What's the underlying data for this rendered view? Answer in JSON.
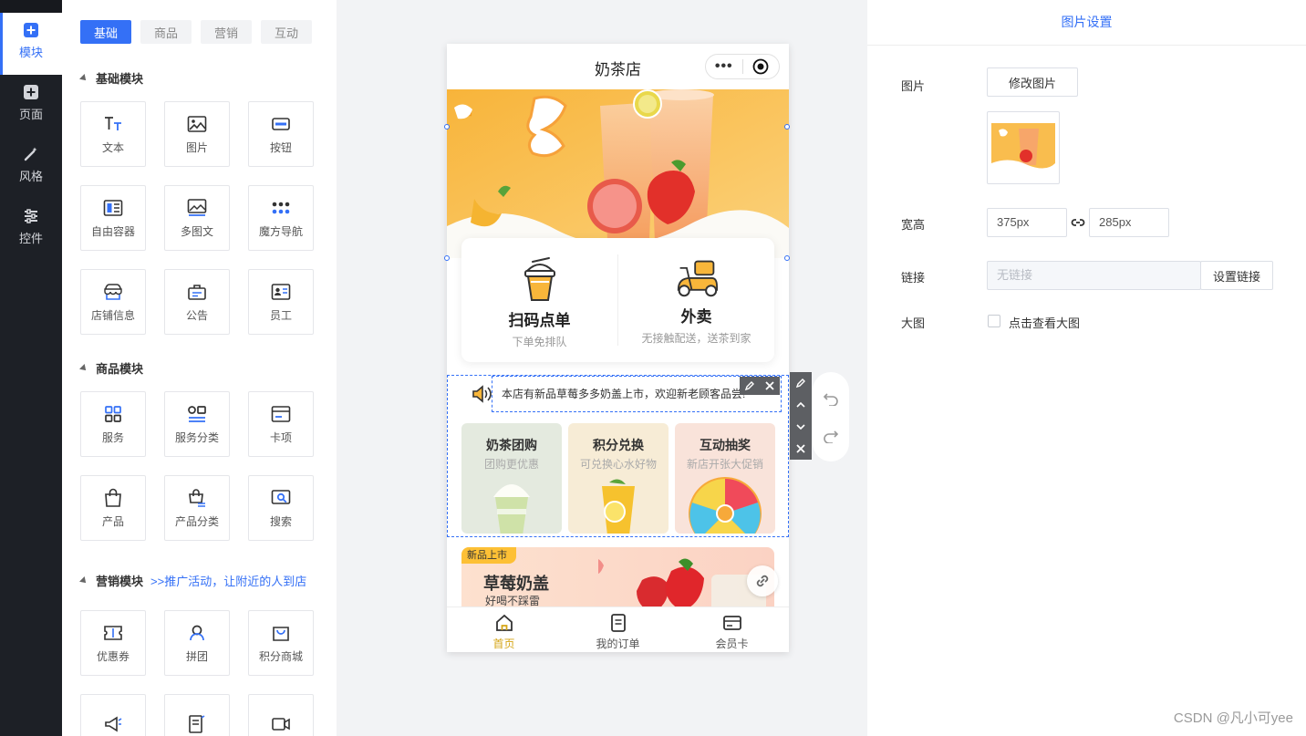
{
  "nav": {
    "items": [
      {
        "label": "模块",
        "icon": "plus-square-icon",
        "active": true
      },
      {
        "label": "页面",
        "icon": "page-plus-icon",
        "active": false
      },
      {
        "label": "风格",
        "icon": "magic-wand-icon",
        "active": false
      },
      {
        "label": "控件",
        "icon": "sliders-icon",
        "active": false
      }
    ]
  },
  "panel": {
    "tabs": [
      "基础",
      "商品",
      "营销",
      "互动"
    ],
    "active_tab": "基础",
    "sections": {
      "basic": {
        "title": "基础模块",
        "items": [
          {
            "label": "文本",
            "icon": "text-icon"
          },
          {
            "label": "图片",
            "icon": "image-icon"
          },
          {
            "label": "按钮",
            "icon": "button-icon"
          },
          {
            "label": "自由容器",
            "icon": "container-icon"
          },
          {
            "label": "多图文",
            "icon": "multi-image-icon"
          },
          {
            "label": "魔方导航",
            "icon": "grid-dots-icon"
          },
          {
            "label": "店铺信息",
            "icon": "store-icon"
          },
          {
            "label": "公告",
            "icon": "notice-icon"
          },
          {
            "label": "员工",
            "icon": "staff-card-icon"
          }
        ]
      },
      "goods": {
        "title": "商品模块",
        "items": [
          {
            "label": "服务",
            "icon": "service-grid-icon"
          },
          {
            "label": "服务分类",
            "icon": "service-category-icon"
          },
          {
            "label": "卡项",
            "icon": "card-icon"
          },
          {
            "label": "产品",
            "icon": "bag-icon"
          },
          {
            "label": "产品分类",
            "icon": "bag-category-icon"
          },
          {
            "label": "搜索",
            "icon": "search-icon"
          }
        ]
      },
      "marketing": {
        "title": "营销模块",
        "hint": ">>推广活动，让附近的人到店",
        "items": [
          {
            "label": "优惠券",
            "icon": "coupon-icon"
          },
          {
            "label": "拼团",
            "icon": "group-buy-icon"
          },
          {
            "label": "积分商城",
            "icon": "points-mall-icon"
          }
        ]
      }
    }
  },
  "phone": {
    "title": "奶茶店",
    "order_card": {
      "left": {
        "name": "扫码点单",
        "sub": "下单免排队",
        "icon": "drink-cup-icon"
      },
      "right": {
        "name": "外卖",
        "sub": "无接触配送，送茶到家",
        "icon": "scooter-icon"
      }
    },
    "notice_text": "本店有新品草莓多多奶盖上市，欢迎新老顾客品尝!",
    "features": [
      {
        "title": "奶茶团购",
        "sub": "团购更优惠",
        "color": "#e4eadf"
      },
      {
        "title": "积分兑换",
        "sub": "可兑换心水好物",
        "color": "#f7ecd6"
      },
      {
        "title": "互动抽奖",
        "sub": "新店开张大促销",
        "color": "#f9e3da"
      }
    ],
    "new_card": {
      "tag": "新品上市",
      "title": "草莓奶盖",
      "sub": "好喝不踩雷"
    },
    "tabbar": [
      {
        "label": "首页",
        "icon": "home-icon",
        "active": true
      },
      {
        "label": "我的订单",
        "icon": "order-icon",
        "active": false
      },
      {
        "label": "会员卡",
        "icon": "member-card-icon",
        "active": false
      }
    ]
  },
  "settings": {
    "title": "图片设置",
    "image_label": "图片",
    "change_image_button": "修改图片",
    "size_label": "宽高",
    "width_value": "375px",
    "height_value": "285px",
    "link_label": "链接",
    "link_placeholder": "无链接",
    "set_link_button": "设置链接",
    "big_image_label": "大图",
    "big_image_checkbox_label": "点击查看大图"
  },
  "watermark": "CSDN @凡小可yee",
  "colors": {
    "accent": "#3470f6",
    "nav_bg": "#1d2026",
    "tab_active": "#d5a516"
  }
}
